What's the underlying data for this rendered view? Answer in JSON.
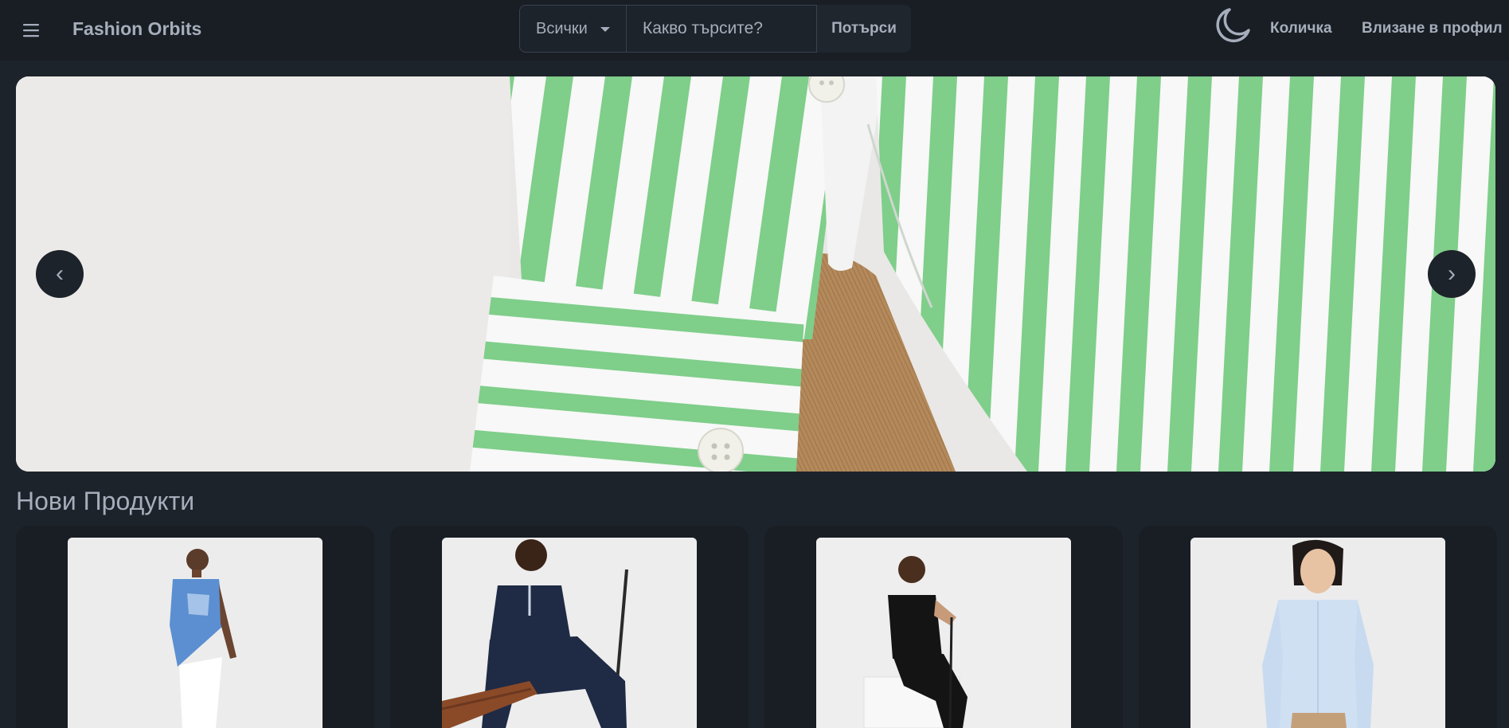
{
  "header": {
    "brand": "Fashion Orbits",
    "menu_icon": "hamburger-icon",
    "theme_icon": "moon-icon",
    "cart_label": "Количка",
    "login_label": "Влизане в профил"
  },
  "search": {
    "category_selected": "Всички",
    "placeholder": "Какво търсите?",
    "button_label": "Потърси"
  },
  "carousel": {
    "prev_label": "‹",
    "next_label": "›"
  },
  "products_section": {
    "title": "Нови Продукти",
    "products": [
      {
        "image": "man-blue-tshirt-white-pants"
      },
      {
        "image": "man-navy-polo-sitting-bench"
      },
      {
        "image": "man-black-polo-sitting-golf-club"
      },
      {
        "image": "man-light-blue-shirt"
      }
    ]
  },
  "colors": {
    "background": "#1d232a",
    "navbar": "#191e24",
    "text": "#a6adbb",
    "stripe_green": "#7fce8a"
  }
}
